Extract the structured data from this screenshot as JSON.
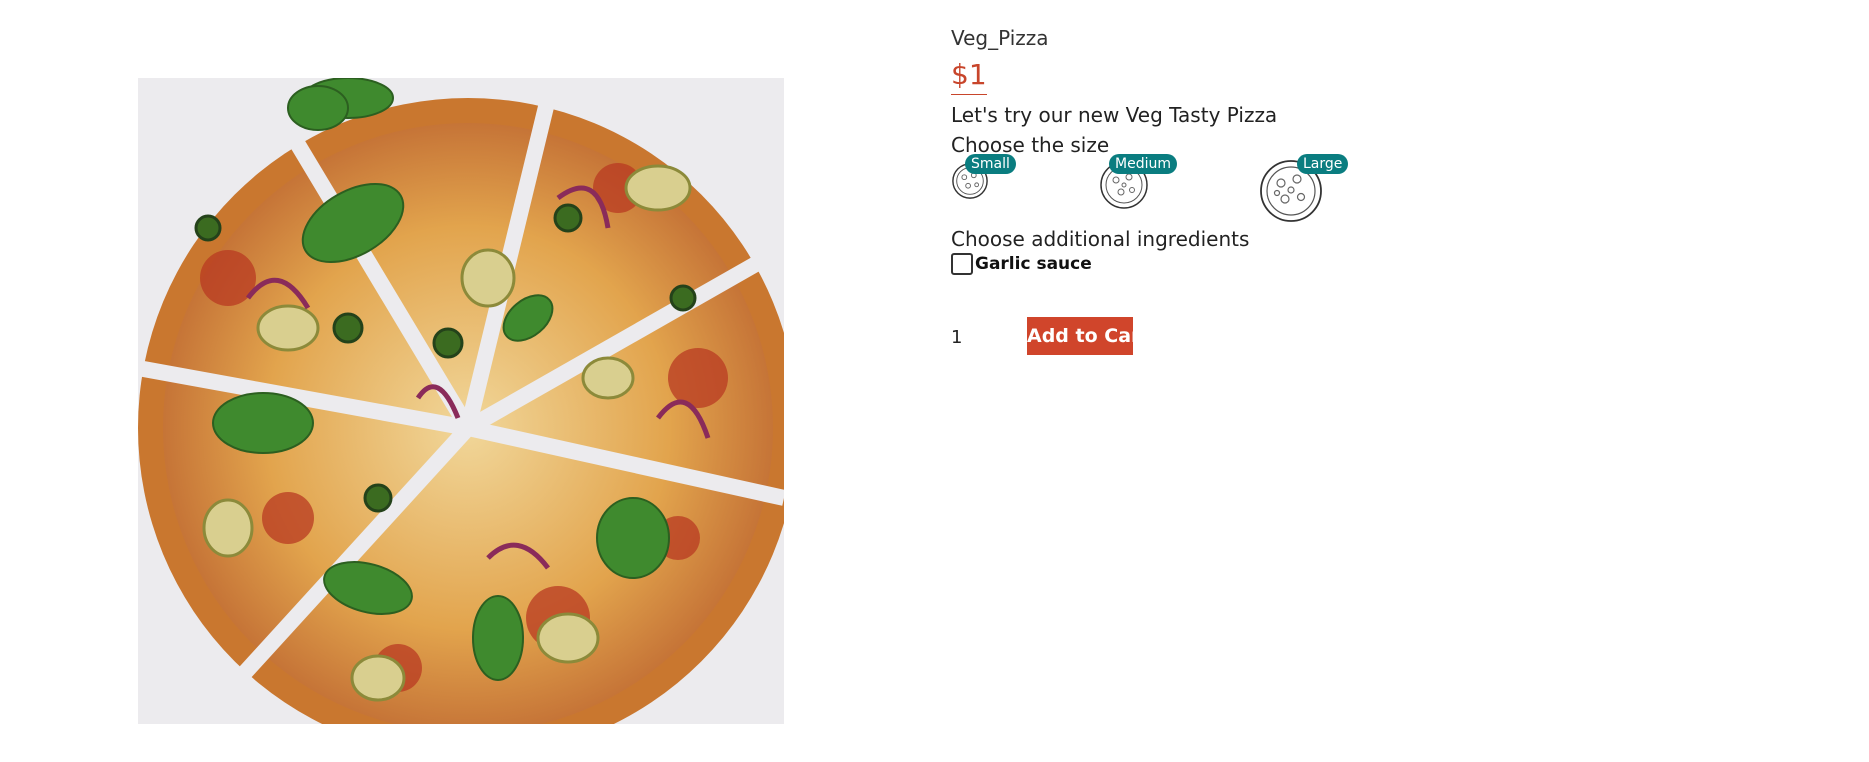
{
  "product": {
    "name": "Veg_Pizza",
    "price": "$1",
    "description": "Let's try our new Veg Tasty Pizza"
  },
  "size_section": {
    "label": "Choose the size",
    "options": [
      {
        "label": "Small",
        "icon": "pizza-small-icon"
      },
      {
        "label": "Medium",
        "icon": "pizza-medium-icon"
      },
      {
        "label": "Large",
        "icon": "pizza-large-icon"
      }
    ]
  },
  "ingredients_section": {
    "label": "Choose additional ingredients",
    "items": [
      {
        "name": "Garlic sauce",
        "checked": false
      }
    ]
  },
  "cart": {
    "quantity": "1",
    "add_label": "Add to Cart"
  },
  "colors": {
    "price": "#c8452b",
    "badge": "#0a7d80",
    "button": "#d0452b"
  }
}
